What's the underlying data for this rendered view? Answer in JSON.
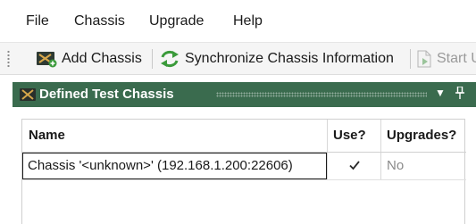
{
  "menu": {
    "items": [
      "File",
      "Chassis",
      "Upgrade",
      "Help"
    ]
  },
  "toolbar": {
    "add_chassis": {
      "label": "Add Chassis",
      "icon": "add-chassis-icon"
    },
    "synchronize": {
      "label": "Synchronize Chassis Information",
      "icon": "sync-icon"
    },
    "start": {
      "label": "Start U",
      "icon": "start-icon",
      "enabled": false
    }
  },
  "panel": {
    "title": "Defined Test Chassis",
    "header_color": "#3a6b4e"
  },
  "grid": {
    "columns": [
      "Name",
      "Use?",
      "Upgrades?"
    ],
    "rows": [
      {
        "name": "Chassis '<unknown>' (192.168.1.200:22606)",
        "use": true,
        "upgrades": "No"
      }
    ]
  }
}
